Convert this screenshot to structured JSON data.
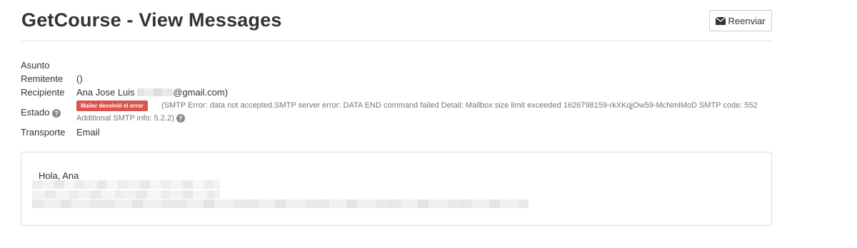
{
  "header": {
    "title": "GetCourse - View Messages",
    "resend_label": "Reenviar"
  },
  "meta": {
    "subject_label": "Asunto",
    "subject_value": "",
    "sender_label": "Remitente",
    "sender_value": "()",
    "recipient_label": "Recipiente",
    "recipient_name": "Ana Jose Luis",
    "recipient_email_suffix": "@gmail.com)",
    "status_label": "Estado",
    "status_badge": "Mailer devolvió el error",
    "status_error_line1": "(SMTP Error: data not accepted.SMTP server error: DATA END command failed Detail: Mailbox size limit exceeded 1626798159-rkXKqjOw59-McNmlMoD SMTP code: 552",
    "status_error_line2": "Additional SMTP info: 5.2.2)",
    "transport_label": "Transporte",
    "transport_value": "Email"
  },
  "message": {
    "greeting": "Hola, Ana"
  },
  "colors": {
    "badge_error": "#d9534f",
    "help_icon": "#8a8a8a",
    "text": "#333333",
    "muted_text": "#777777"
  },
  "icons": {
    "resend": "envelope-icon",
    "help": "question-circle-icon"
  }
}
